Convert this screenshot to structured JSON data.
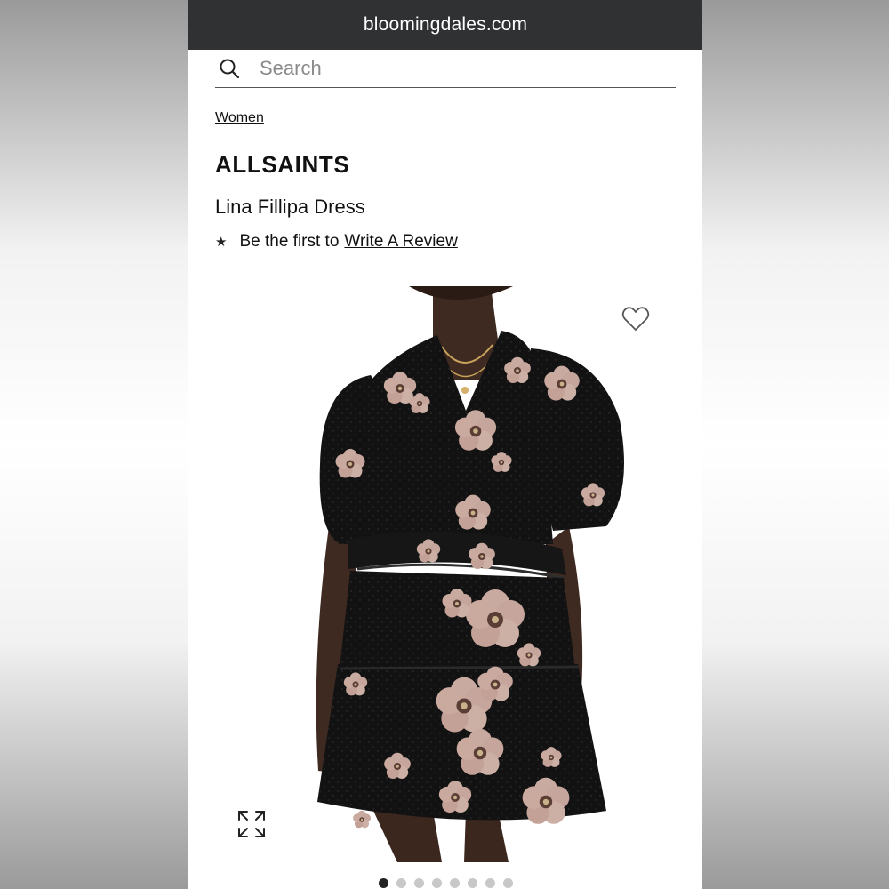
{
  "browser": {
    "url": "bloomingdales.com"
  },
  "search": {
    "placeholder": "Search",
    "icon": "search-icon"
  },
  "breadcrumb": {
    "label": "Women"
  },
  "product": {
    "brand": "ALLSAINTS",
    "name": "Lina Fillipa Dress",
    "review_prompt": "Be the first to",
    "review_link": "Write A Review",
    "image_alt": "Model wearing black floral print mini dress with puff sleeves"
  },
  "carousel": {
    "total": 8,
    "active_index": 0
  },
  "colors": {
    "url_bar": "#2f3133",
    "dress": "#121212",
    "flower": "#c9aaa0"
  }
}
